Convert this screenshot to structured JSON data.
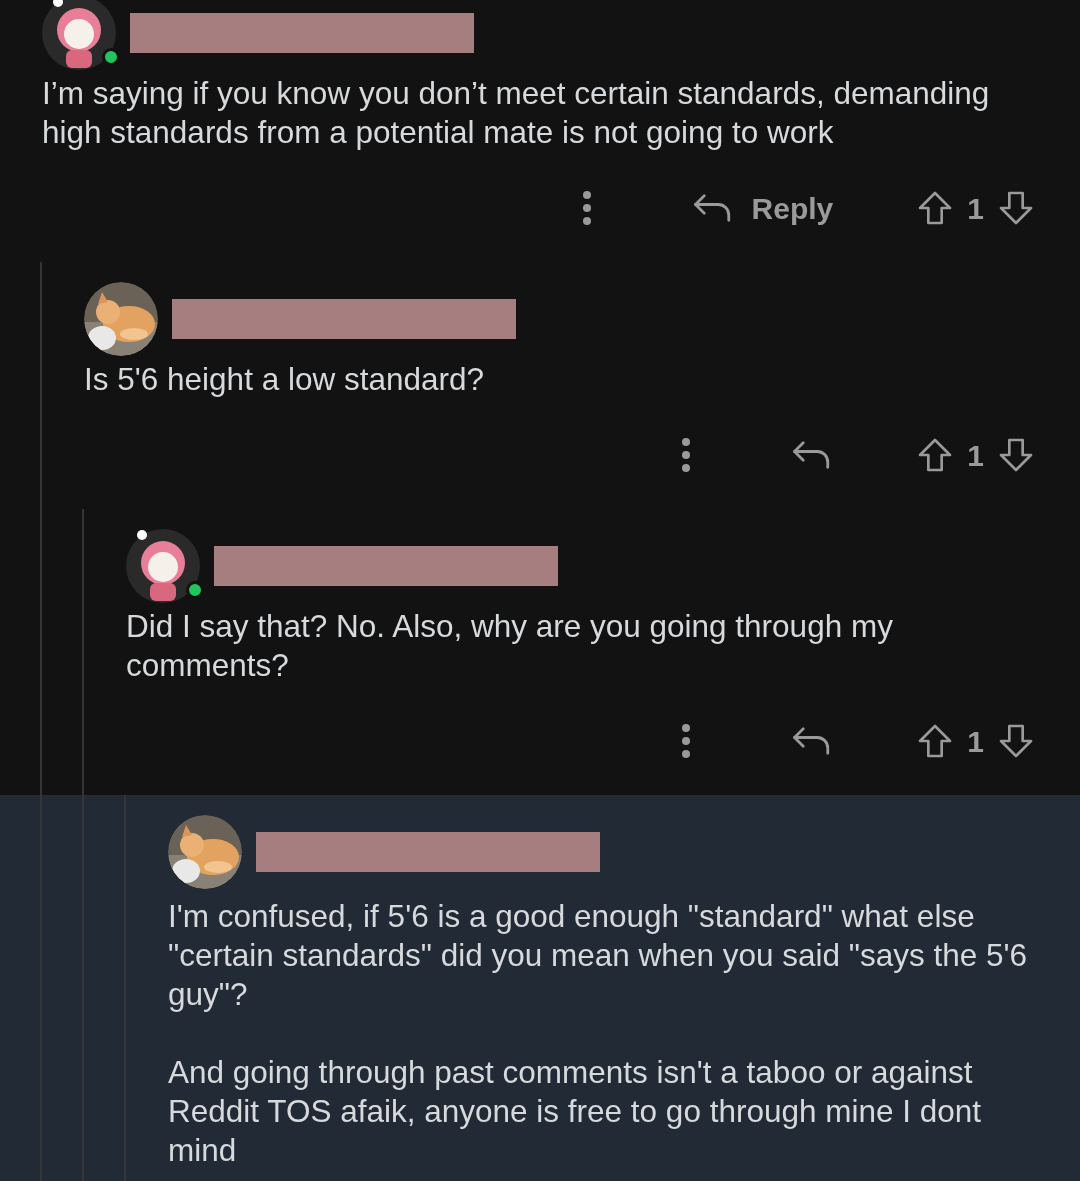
{
  "comments": [
    {
      "kind": "character",
      "online": true,
      "highlighted": false,
      "paragraphs": [
        "I’m saying if you know you don’t meet certain standards, demanding high standards from a potential mate is not going to work"
      ],
      "reply_label": "Reply",
      "votes": "1",
      "children": [
        {
          "online": false,
          "highlighted": false,
          "paragraphs": [
            "Is 5'6 height a low standard?"
          ],
          "votes": "1",
          "children": [
            {
              "kind": "character",
              "online": true,
              "highlighted": false,
              "paragraphs": [
                "Did I say that? No. Also, why are you going through my comments?"
              ],
              "votes": "1",
              "children": [
                {
                  "online": false,
                  "highlighted": true,
                  "paragraphs": [
                    "I'm confused, if 5'6 is a good enough \"standard\" what else \"certain standards\" did you mean when you said \"says the 5'6 guy\"?",
                    "And going through past comments isn't a taboo or against Reddit TOS afaik, anyone is free to go through mine I dont mind"
                  ]
                }
              ]
            }
          ]
        }
      ]
    }
  ]
}
